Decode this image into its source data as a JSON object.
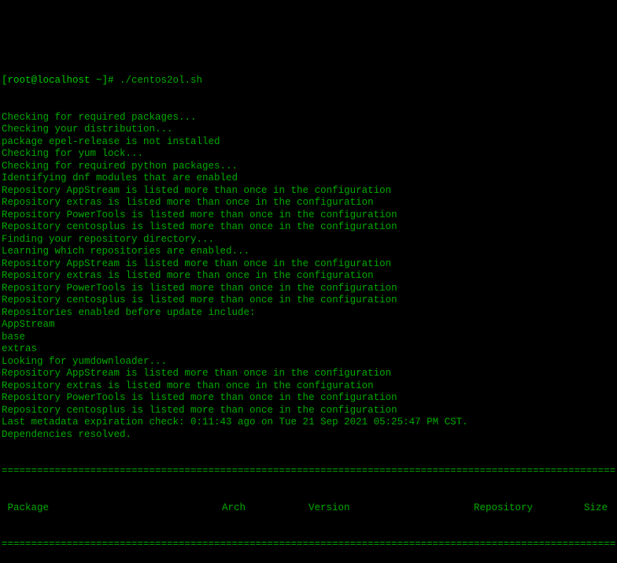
{
  "prompt": "[root@localhost ~]# ",
  "command": "./centos2ol.sh",
  "lines": [
    "Checking for required packages...",
    "Checking your distribution...",
    "package epel-release is not installed",
    "Checking for yum lock...",
    "Checking for required python packages...",
    "Identifying dnf modules that are enabled",
    "Repository AppStream is listed more than once in the configuration",
    "Repository extras is listed more than once in the configuration",
    "Repository PowerTools is listed more than once in the configuration",
    "Repository centosplus is listed more than once in the configuration",
    "Finding your repository directory...",
    "Learning which repositories are enabled...",
    "Repository AppStream is listed more than once in the configuration",
    "Repository extras is listed more than once in the configuration",
    "Repository PowerTools is listed more than once in the configuration",
    "Repository centosplus is listed more than once in the configuration",
    "Repositories enabled before update include:",
    "AppStream",
    "base",
    "extras",
    "Looking for yumdownloader...",
    "Repository AppStream is listed more than once in the configuration",
    "Repository extras is listed more than once in the configuration",
    "Repository PowerTools is listed more than once in the configuration",
    "Repository centosplus is listed more than once in the configuration",
    "Last metadata expiration check: 0:11:43 ago on Tue 21 Sep 2021 05:25:47 PM CST.",
    "Dependencies resolved."
  ],
  "divider": "================================================================================================================",
  "table_headers": {
    "package": " Package",
    "arch": "Arch",
    "version": "Version",
    "repository": "Repository",
    "size": "Size"
  }
}
